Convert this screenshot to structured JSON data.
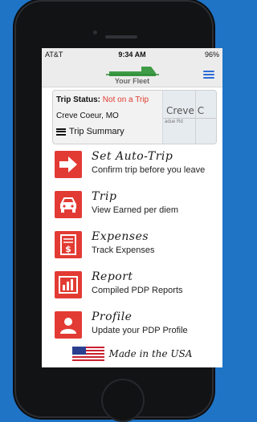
{
  "statusbar": {
    "carrier": "AT&T",
    "time": "9:34 AM",
    "battery": "96%"
  },
  "header": {
    "brand": "Your Fleet"
  },
  "trip_card": {
    "status_label": "Trip Status:",
    "status_value": "Not on a Trip",
    "location": "Creve Coeur, MO",
    "summary_label": "Trip Summary",
    "map_city": "Creve C",
    "map_street": "adue Rd"
  },
  "menu": [
    {
      "title": "Set Auto-Trip",
      "subtitle": "Confirm trip before you leave",
      "icon": "arrow-right-icon"
    },
    {
      "title": "Trip",
      "subtitle": "View Earned per diem",
      "icon": "car-icon"
    },
    {
      "title": "Expenses",
      "subtitle": "Track Expenses",
      "icon": "receipt-icon"
    },
    {
      "title": "Report",
      "subtitle": "Compiled PDP Reports",
      "icon": "chart-icon"
    },
    {
      "title": "Profile",
      "subtitle": "Update your PDP Profile",
      "icon": "person-icon"
    }
  ],
  "footer": {
    "made_in": "Made in the USA"
  },
  "colors": {
    "accent": "#e23b33",
    "background": "#1f74c6",
    "menu_icon": "#2c6bd6",
    "status_value": "#e03a2f"
  }
}
